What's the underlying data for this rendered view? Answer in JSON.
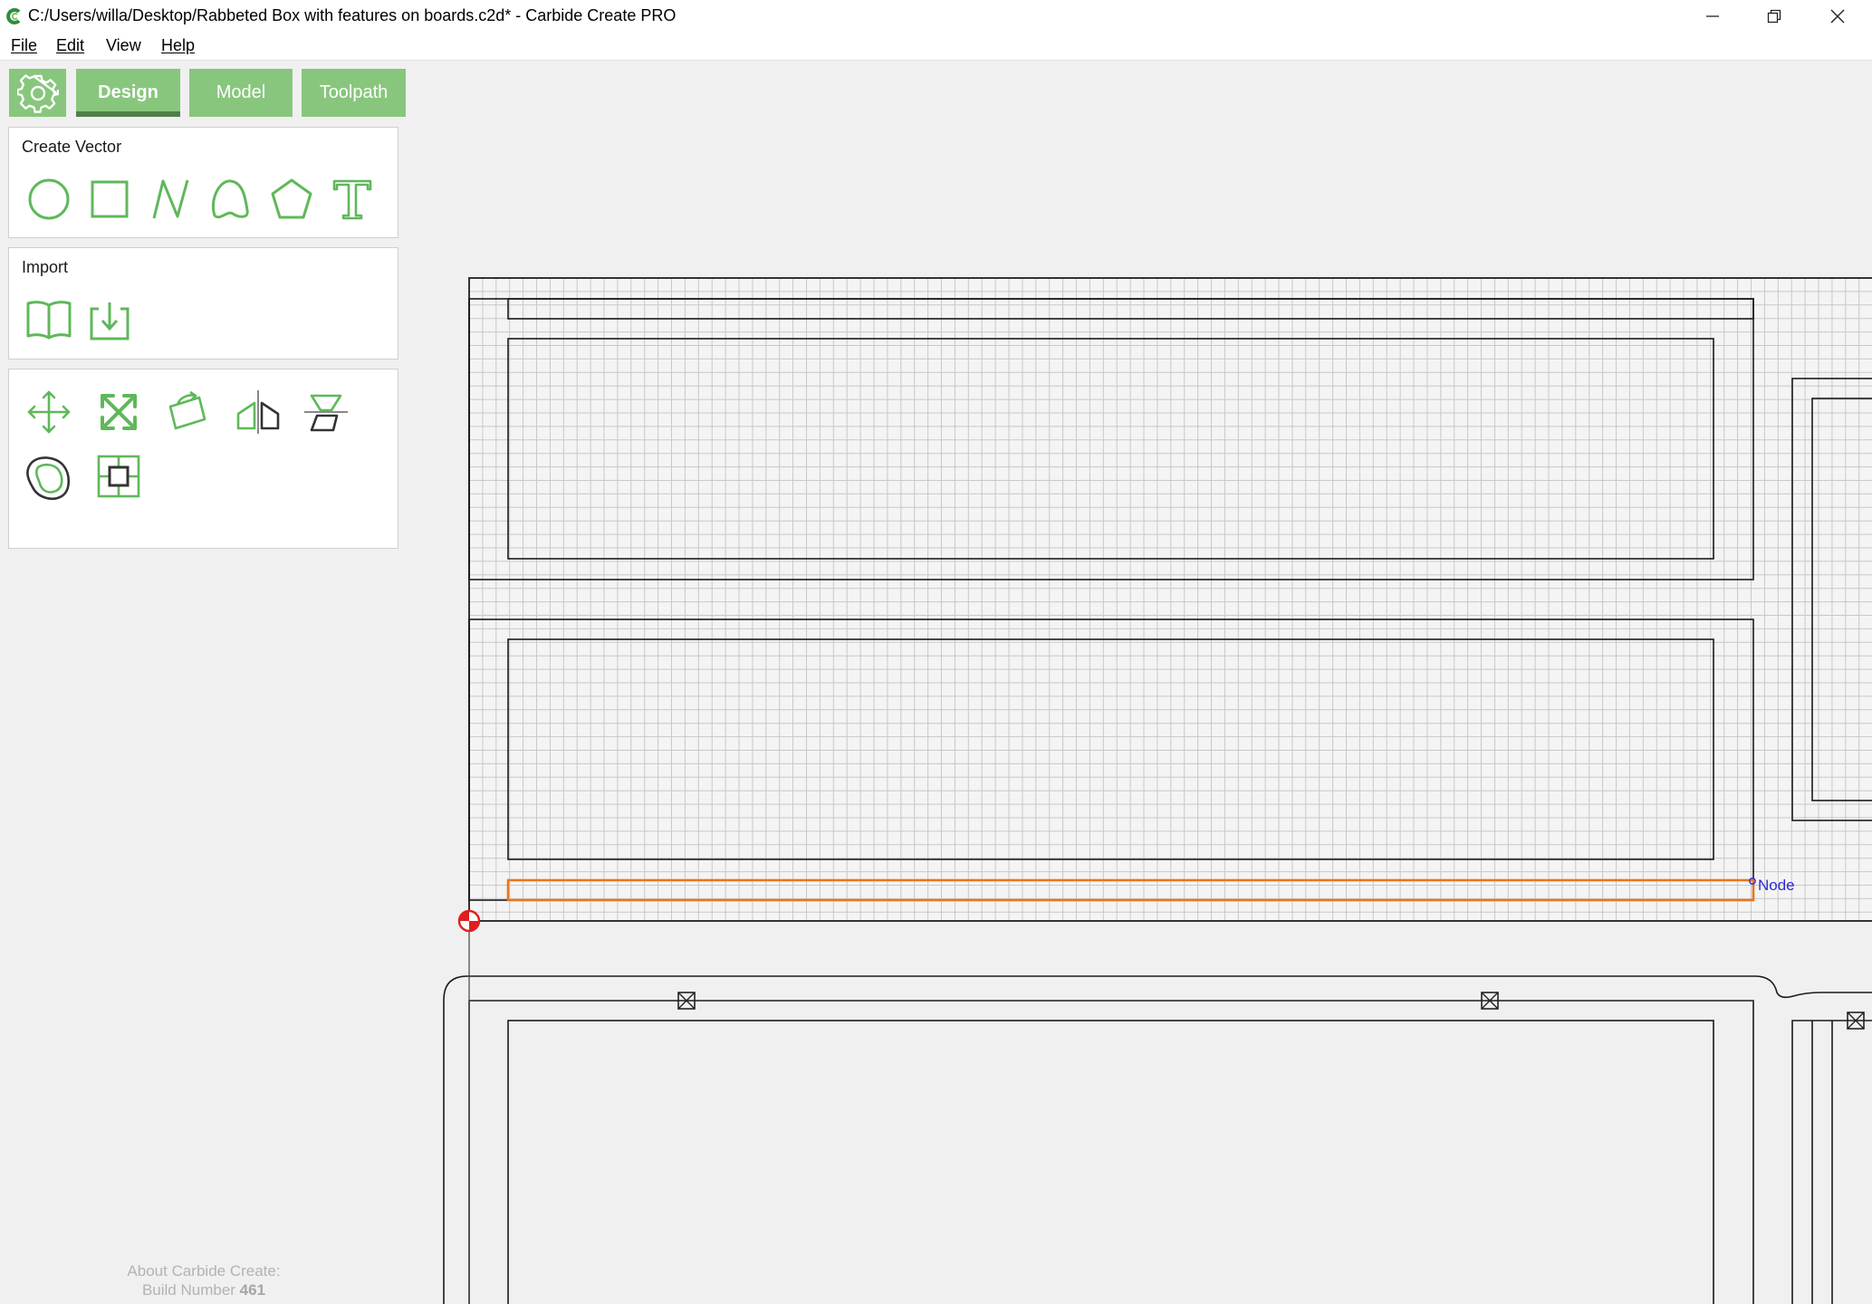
{
  "window": {
    "title": "C:/Users/willa/Desktop/Rabbeted Box with features on boards.c2d* - Carbide Create PRO",
    "app_icon": "carbide-logo-icon",
    "controls": [
      "minimize-icon",
      "restore-icon",
      "close-icon"
    ]
  },
  "menu": {
    "items": [
      {
        "label": "File"
      },
      {
        "label": "Edit"
      },
      {
        "label": "View"
      },
      {
        "label": "Help"
      }
    ]
  },
  "mode_tabs": {
    "settings_icon": "gear-icon",
    "tabs": [
      {
        "label": "Design",
        "active": true
      },
      {
        "label": "Model",
        "active": false
      },
      {
        "label": "Toolpath",
        "active": false
      }
    ]
  },
  "create_vector": {
    "title": "Create Vector",
    "tools": [
      "circle-icon",
      "rectangle-icon",
      "polyline-icon",
      "curve-icon",
      "polygon-icon",
      "text-icon"
    ]
  },
  "import": {
    "title": "Import",
    "tools": [
      "library-book-icon",
      "import-file-icon"
    ]
  },
  "transform": {
    "tools": [
      "move-icon",
      "scale-icon",
      "rotate-icon",
      "mirror-icon",
      "align-icon",
      "offset-icon",
      "boolean-icon"
    ]
  },
  "canvas": {
    "node_label": "Node",
    "colors": {
      "grid": "#c8c8c8",
      "vector": "#1a1a1a",
      "selected": "#e8761e",
      "node": "#2b2bd6",
      "origin": "#e01e1e"
    }
  },
  "about": {
    "line1": "About Carbide Create:",
    "line2_prefix": "Build Number ",
    "build_number": "461"
  },
  "colors": {
    "accent": "#88c67d",
    "accent_dark": "#4d7f4a",
    "icon_green": "#5fb85a"
  }
}
